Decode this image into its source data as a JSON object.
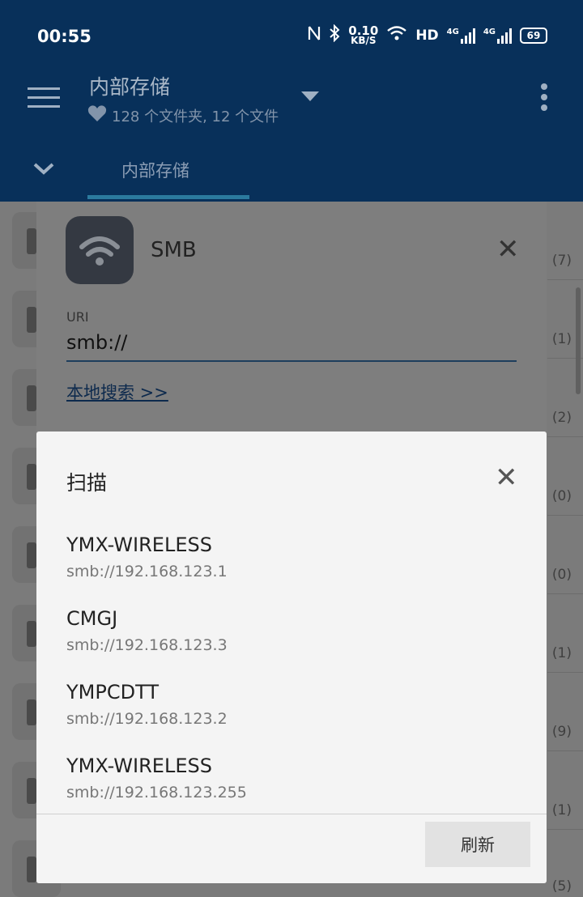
{
  "status_bar": {
    "time": "00:55",
    "nfc_icon": "nfc-icon",
    "bluetooth_icon": "bluetooth-icon",
    "speed_value": "0.10",
    "speed_unit": "KB/S",
    "hd_label": "HD",
    "network_label_1": "4G",
    "network_label_2": "4G",
    "battery": "69"
  },
  "app_bar": {
    "title": "内部存储",
    "subtitle": "128 个文件夹, 12 个文件",
    "tab_label": "内部存储"
  },
  "background_counts": [
    "(7)",
    "(1)",
    "(2)",
    "(0)",
    "(0)",
    "(1)",
    "(9)",
    "(1)",
    "(5)"
  ],
  "smb_dialog": {
    "title": "SMB",
    "uri_label": "URI",
    "uri_value": "smb://",
    "local_search": "本地搜索 >>"
  },
  "scan_dialog": {
    "title": "扫描",
    "items": [
      {
        "name": "YMX-WIRELESS",
        "url": "smb://192.168.123.1"
      },
      {
        "name": "CMGJ",
        "url": "smb://192.168.123.3"
      },
      {
        "name": "YMPCDTT",
        "url": "smb://192.168.123.2"
      },
      {
        "name": "YMX-WIRELESS",
        "url": "smb://192.168.123.255"
      }
    ],
    "refresh_label": "刷新"
  },
  "colors": {
    "app_bar": "#08305a",
    "dialog_bg": "#f4f4f4",
    "scrim": "#7b7b7b"
  }
}
